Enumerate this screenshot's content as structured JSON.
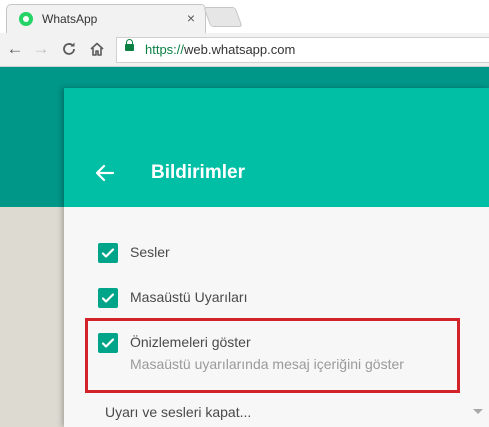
{
  "browser": {
    "tab_title": "WhatsApp",
    "tab_close": "×",
    "address": {
      "scheme": "https://",
      "host": "web.whatsapp.com"
    }
  },
  "drawer": {
    "title": "Bildirimler"
  },
  "settings": {
    "options": [
      {
        "label": "Sesler",
        "checked": true
      },
      {
        "label": "Masaüstü Uyarıları",
        "checked": true
      },
      {
        "label": "Önizlemeleri göster",
        "description": "Masaüstü uyarılarında mesaj içeriğini göster",
        "checked": true
      }
    ],
    "mute_label": "Uyarı ve sesleri kapat..."
  },
  "colors": {
    "header_green": "#00bfa5",
    "app_bar_dark": "#009688",
    "checkbox": "#00a589",
    "highlight_box": "#d2232a"
  }
}
